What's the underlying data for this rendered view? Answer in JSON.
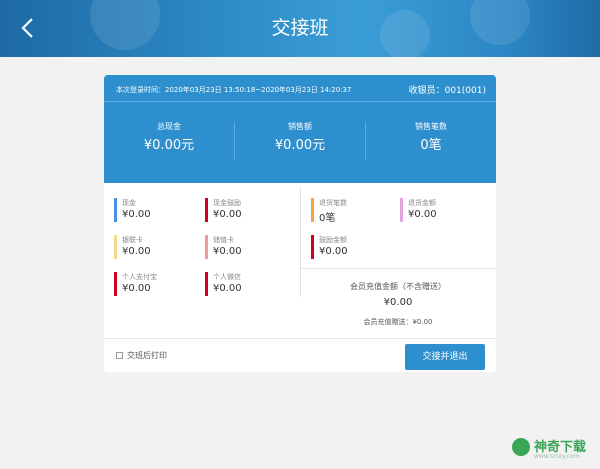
{
  "header": {
    "title": "交接班",
    "back_icon": "chevron-left-icon"
  },
  "shift": {
    "login_time": "本次登录时间：2020年03月23日 13:50:18~2020年03月23日 14:20:37",
    "cashier": "收银员：001(001)"
  },
  "summary": [
    {
      "label": "总现金",
      "value": "¥0.00元"
    },
    {
      "label": "销售额",
      "value": "¥0.00元"
    },
    {
      "label": "销售笔数",
      "value": "0笔"
    }
  ],
  "payments": [
    {
      "label": "现金",
      "value": "¥0.00",
      "color": "#4a90e2"
    },
    {
      "label": "现金鼓励",
      "value": "¥0.00",
      "color": "#d0021b"
    },
    {
      "label": "银联卡",
      "value": "¥0.00",
      "color": "#f5d98b"
    },
    {
      "label": "储值卡",
      "value": "¥0.00",
      "color": "#f19a9a"
    },
    {
      "label": "个人支付宝",
      "value": "¥0.00",
      "color": "#d0021b"
    },
    {
      "label": "个人微信",
      "value": "¥0.00",
      "color": "#d0021b"
    }
  ],
  "refunds": [
    {
      "label": "退货笔数",
      "value": "0笔",
      "color": "#f5a04b"
    },
    {
      "label": "退货金额",
      "value": "¥0.00",
      "color": "#e3a3e0"
    },
    {
      "label": "鼓励金额",
      "value": "¥0.00",
      "color": "#d0021b"
    }
  ],
  "recharge": {
    "title": "会员充值金额（不含赠送）",
    "value": "¥0.00",
    "gift": "会员充值赠送：¥0.00"
  },
  "footer": {
    "print_label": "交班后打印",
    "print_checked": false,
    "submit_label": "交接并退出"
  },
  "watermark": {
    "text": "神奇下载",
    "url": "www.smzy.com"
  }
}
